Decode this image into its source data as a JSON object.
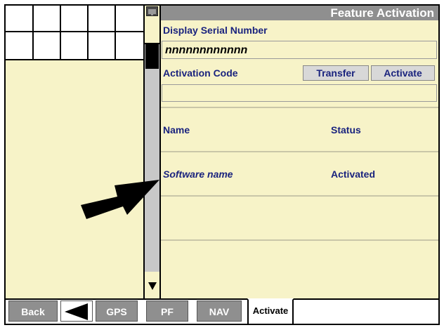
{
  "window": {
    "title": "Feature Activation"
  },
  "form": {
    "serial_label": "Display Serial Number",
    "serial_value": "nnnnnnnnnnnn",
    "code_label": "Activation Code",
    "code_value": "",
    "transfer_label": "Transfer",
    "activate_label": "Activate"
  },
  "table": {
    "headers": {
      "name": "Name",
      "status": "Status"
    },
    "rows": [
      {
        "name": "Software name",
        "status": "Activated"
      }
    ]
  },
  "tabs": {
    "back": "Back",
    "gps": "GPS",
    "pf": "PF",
    "nav": "NAV",
    "activate": "Activate"
  },
  "icons": {
    "scroll_down": "triangle-down-icon",
    "back_arrow": "triangle-left-icon",
    "pointer": "arrow-icon",
    "title": "display-icon"
  },
  "colors": {
    "panel": "#f7f3c8",
    "title_bar": "#8f8f8f",
    "label_text": "#1a237e"
  }
}
